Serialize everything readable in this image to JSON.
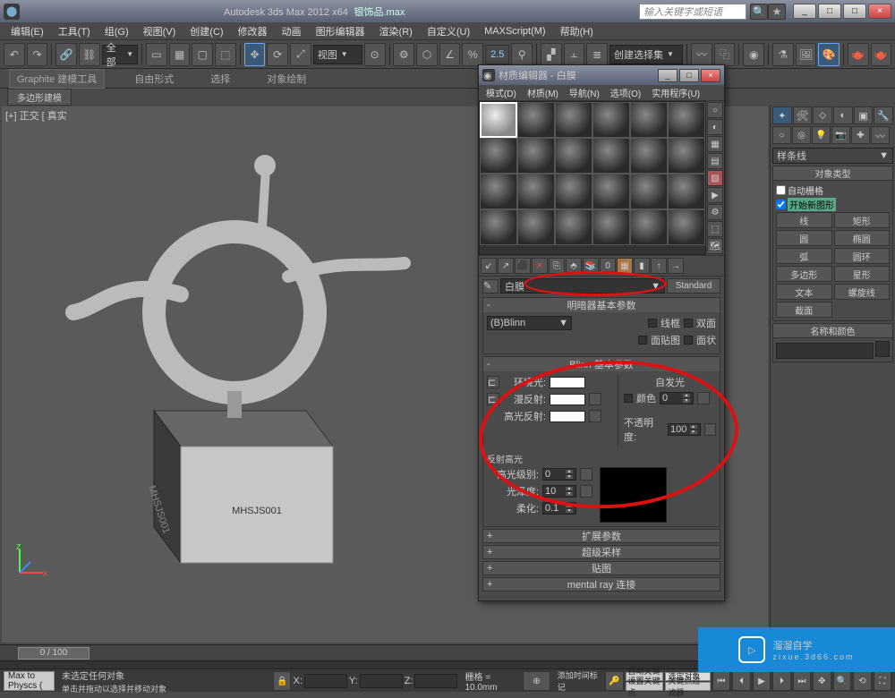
{
  "app": {
    "title": "Autodesk 3ds Max  2012 x64",
    "file": "银饰品.max",
    "search_ph": "输入关键字或短语"
  },
  "win": {
    "min": "_",
    "max": "□",
    "close": "×"
  },
  "menu": [
    "编辑(E)",
    "工具(T)",
    "组(G)",
    "视图(V)",
    "创建(C)",
    "修改器",
    "动画",
    "图形编辑器",
    "渲染(R)",
    "自定义(U)",
    "MAXScript(M)",
    "帮助(H)"
  ],
  "toolbar": {
    "sel_set": "全部",
    "snap": "2.5",
    "named_sel": "创建选择集"
  },
  "ribbon": {
    "a": "Graphite 建模工具",
    "b": "自由形式",
    "c": "选择",
    "d": "对象绘制"
  },
  "tab": "多边形建模",
  "vp_label": "[+] 正交 [ 真实",
  "pedestal": "MHSJS001",
  "cmd": {
    "dd": "样条线",
    "roll_type": "对象类型",
    "autogrid": "自动栅格",
    "start": "开始新图形",
    "btns": [
      "线",
      "矩形",
      "圆",
      "椭圆",
      "弧",
      "圆环",
      "多边形",
      "星形",
      "文本",
      "螺旋线",
      "截面"
    ],
    "roll_name": "名称和颜色"
  },
  "mat": {
    "title": "材质编辑器 - 白膜",
    "menu": [
      "模式(D)",
      "材质(M)",
      "导航(N)",
      "选项(O)",
      "实用程序(U)"
    ],
    "name": "白膜",
    "type": "Standard",
    "roll1": "明暗器基本参数",
    "shader": "(B)Blinn",
    "wire": "线框",
    "twoside": "双面",
    "facemap": "面贴图",
    "faceted": "面状",
    "roll2": "Blinn 基本参数",
    "ambient": "环境光:",
    "diffuse": "漫反射:",
    "specular": "高光反射:",
    "selfillum": "自发光",
    "color": "颜色",
    "opacity": "不透明度:",
    "si_val": "0",
    "op_val": "100",
    "spec_hl": "反射高光",
    "spec_level": "高光级别:",
    "gloss": "光泽度:",
    "soften": "柔化:",
    "sl_val": "0",
    "gl_val": "10",
    "sf_val": "0.1",
    "c1": "扩展参数",
    "c2": "超级采样",
    "c3": "贴图",
    "c4": "mental ray 连接"
  },
  "status": {
    "script": "Max to Physcs (",
    "none": "未选定任何对象",
    "hint": "单击并拖动以选择并移动对象",
    "add_tag": "添加时间标记",
    "grid": "栅格 = 10.0mm",
    "auto": "自动关键点",
    "selkey": "选定对象",
    "setkey": "设置关键点",
    "filter": "关键点过滤器",
    "frame": "0 / 100",
    "x": "X:",
    "y": "Y:",
    "z": "Z:"
  },
  "wm": {
    "brand": "溜溜自学",
    "url": "zixue.3d66.com"
  }
}
